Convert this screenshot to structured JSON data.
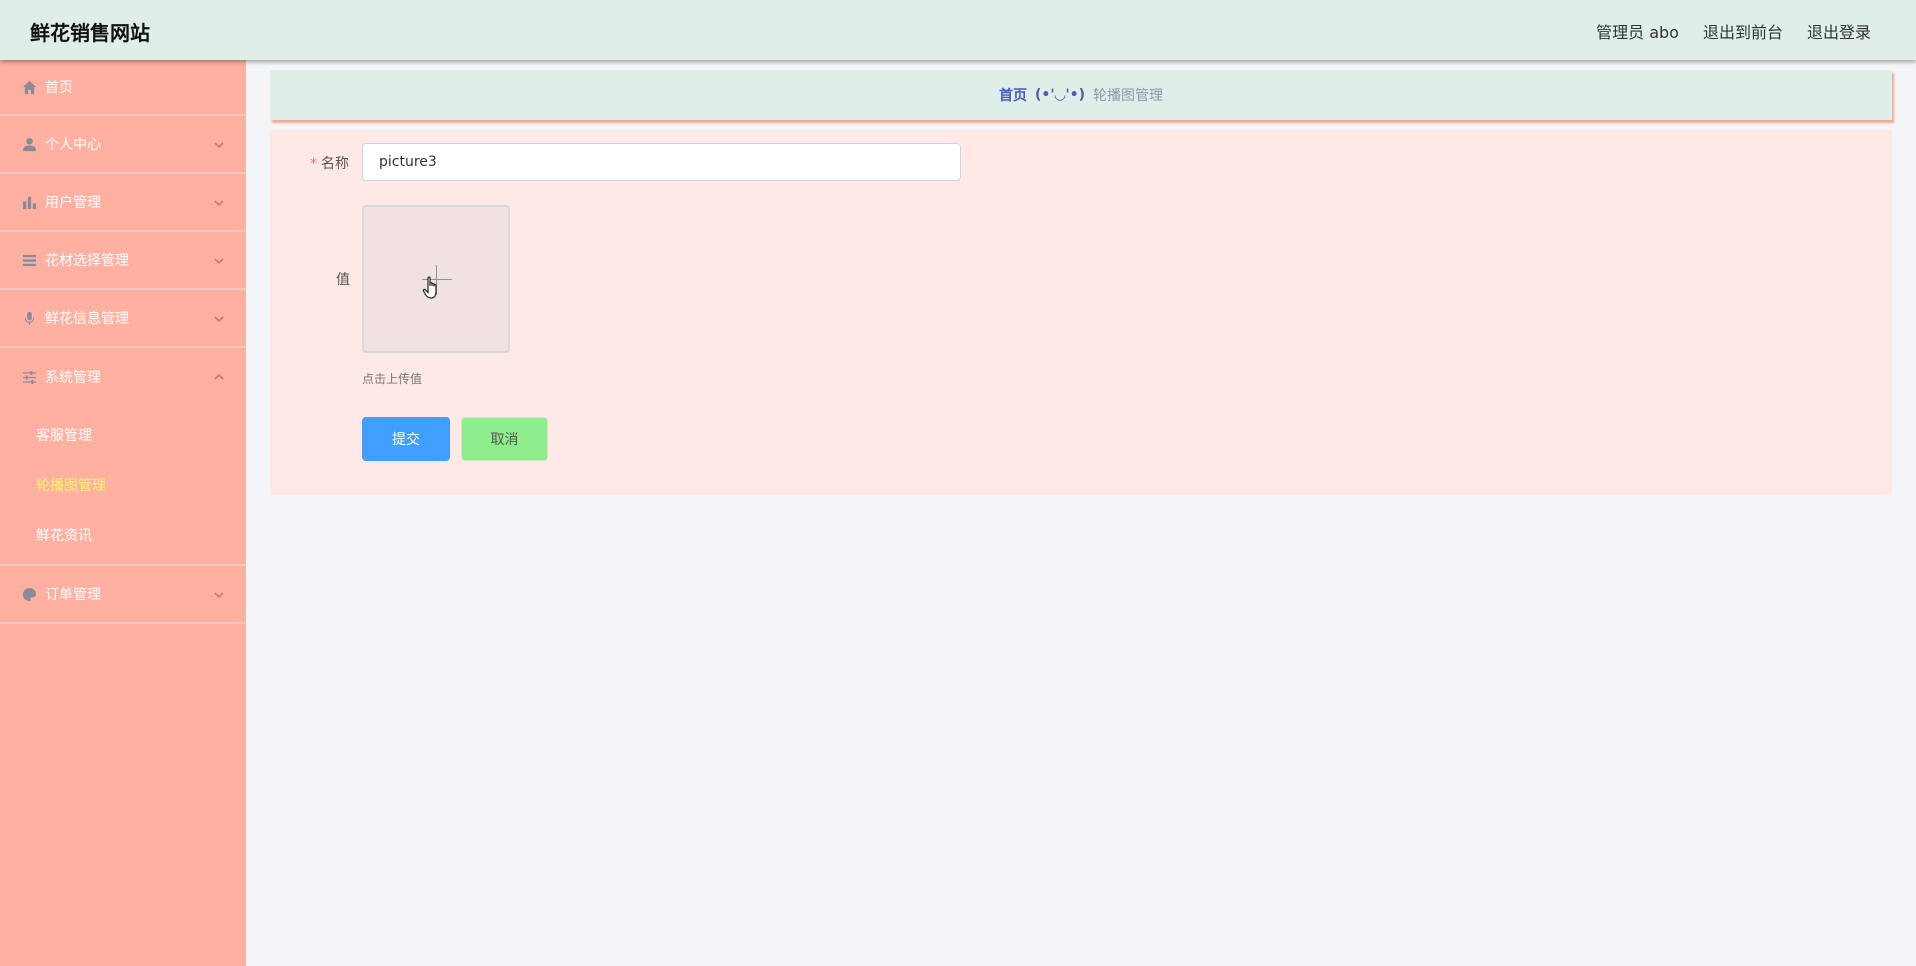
{
  "header": {
    "title": "鲜花销售网站",
    "user_label": "管理员 abo",
    "to_front_label": "退出到前台",
    "logout_label": "退出登录"
  },
  "sidebar": {
    "items": [
      {
        "label": "首页",
        "icon": "home-icon"
      },
      {
        "label": "个人中心",
        "icon": "user-icon"
      },
      {
        "label": "用户管理",
        "icon": "bar-chart-icon"
      },
      {
        "label": "花材选择管理",
        "icon": "list-icon"
      },
      {
        "label": "鲜花信息管理",
        "icon": "microphone-icon"
      },
      {
        "label": "系统管理",
        "icon": "sliders-icon"
      },
      {
        "label": "订单管理",
        "icon": "paint-icon"
      }
    ],
    "system_submenu": [
      {
        "label": "客服管理"
      },
      {
        "label": "轮播图管理"
      },
      {
        "label": "鲜花资讯"
      }
    ],
    "active_sub_color": "#f6f66a"
  },
  "breadcrumb": {
    "home": "首页",
    "separator": "(•'◡'•)",
    "current": "轮播图管理"
  },
  "form": {
    "name_label": "名称",
    "name_value": "picture3",
    "value_label": "值",
    "upload_tip": "点击上传值",
    "submit_label": "提交",
    "cancel_label": "取消"
  },
  "colors": {
    "header_bg": "#dfeee6",
    "sidebar_bg": "#ffb0a1",
    "panel_bg": "#ffe9e6",
    "submit_bg": "#409eff",
    "cancel_bg": "#8eee8b"
  }
}
